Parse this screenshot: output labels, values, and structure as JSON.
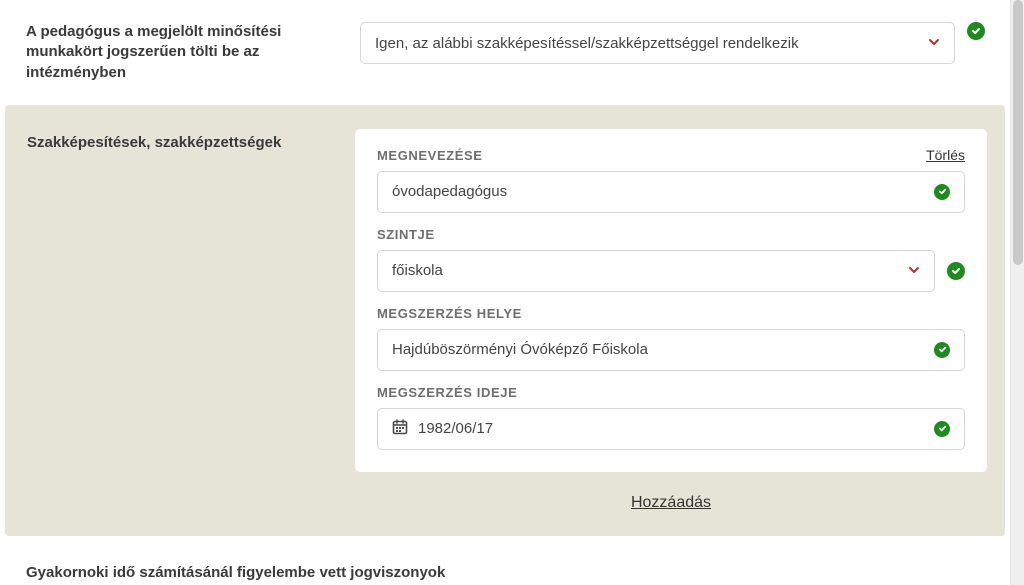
{
  "role_row": {
    "label": "A pedagógus a megjelölt minősítési munkakört jogszerűen tölti be az intézményben",
    "value": "Igen, az alábbi szakképesítéssel/szakképzettséggel rendelkezik"
  },
  "qualifications_panel": {
    "heading": "Szakképesítések, szakképzettségek",
    "delete_label": "Törlés",
    "add_label": "Hozzáadás",
    "fields": {
      "name": {
        "label": "MEGNEVEZÉSE",
        "value": "óvodapedagógus"
      },
      "level": {
        "label": "SZINTJE",
        "value": "főiskola"
      },
      "place": {
        "label": "MEGSZERZÉS HELYE",
        "value": "Hajdúböszörményi Óvóképző Főiskola"
      },
      "date": {
        "label": "MEGSZERZÉS IDEJE",
        "value": "1982/06/17"
      }
    }
  },
  "gyakornoki_section": {
    "title": "Gyakornoki idő számításánál figyelembe vett jogviszonyok"
  }
}
